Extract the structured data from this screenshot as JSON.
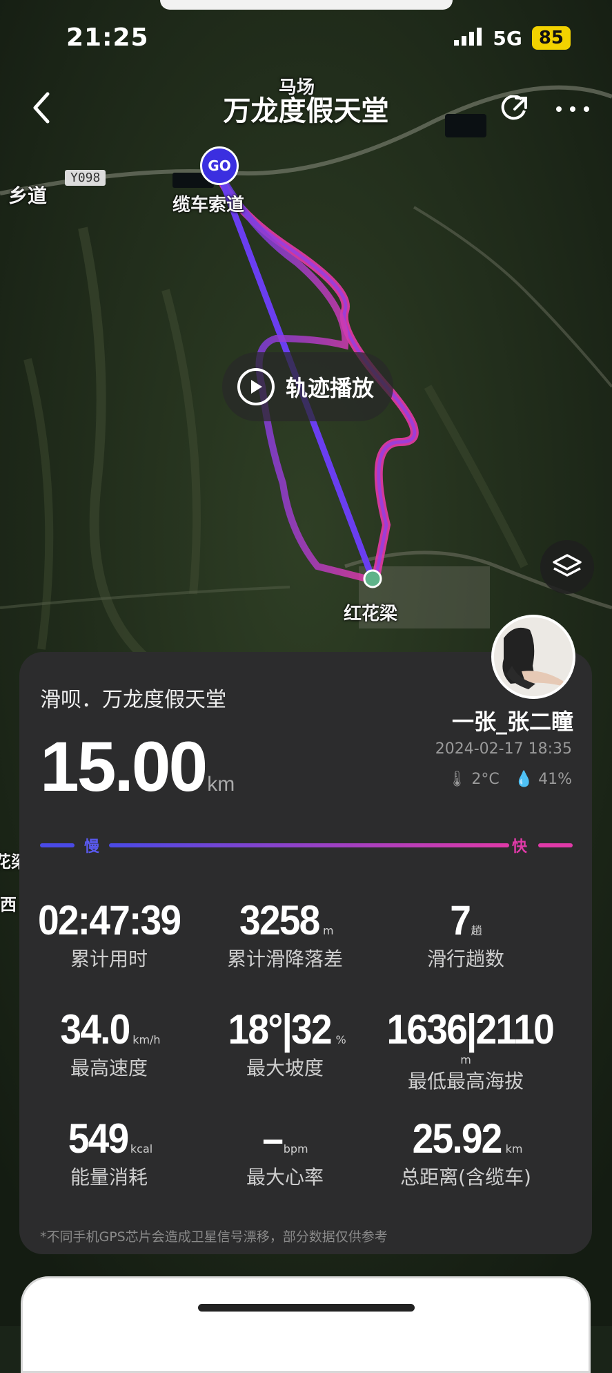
{
  "status_bar": {
    "time": "21:25",
    "network": "5G",
    "battery": "85"
  },
  "nav": {
    "title": "万龙度假天堂"
  },
  "map": {
    "labels": {
      "ranch": "马场",
      "village_road": "乡道",
      "road_code": "Y098",
      "cable_station": "缆车索道",
      "end_point": "红花梁",
      "edge_1": "花梁",
      "edge_2": "西"
    },
    "start_marker": "GO",
    "play_label": "轨迹播放"
  },
  "card": {
    "title": "滑呗．万龙度假天堂",
    "username": "一张_张二瞳",
    "datetime": "2024-02-17 18:35",
    "temperature": "2°C",
    "humidity": "41%",
    "distance": {
      "value": "15.00",
      "unit": "km"
    },
    "speed_legend": {
      "slow": "慢",
      "fast": "快",
      "slow_color": "#4a4ae6",
      "fast_color": "#e03aa8"
    },
    "stats": [
      {
        "value": "02:47:39",
        "unit": "",
        "label": "累计用时"
      },
      {
        "value": "3258",
        "unit": "m",
        "label": "累计滑降落差"
      },
      {
        "value": "7",
        "unit": "趟",
        "label": "滑行趟数"
      },
      {
        "value": "34.0",
        "unit": "km/h",
        "label": "最高速度"
      },
      {
        "value": "18°|32",
        "unit": "%",
        "label": "最大坡度"
      },
      {
        "value": "1636|2110",
        "unit": "m",
        "label": "最低最高海拔"
      },
      {
        "value": "549",
        "unit": "kcal",
        "label": "能量消耗"
      },
      {
        "value": "–",
        "unit": "bpm",
        "label": "最大心率"
      },
      {
        "value": "25.92",
        "unit": "km",
        "label": "总距离(含缆车)"
      }
    ],
    "disclaimer": "*不同手机GPS芯片会造成卫星信号漂移，部分数据仅供参考"
  }
}
